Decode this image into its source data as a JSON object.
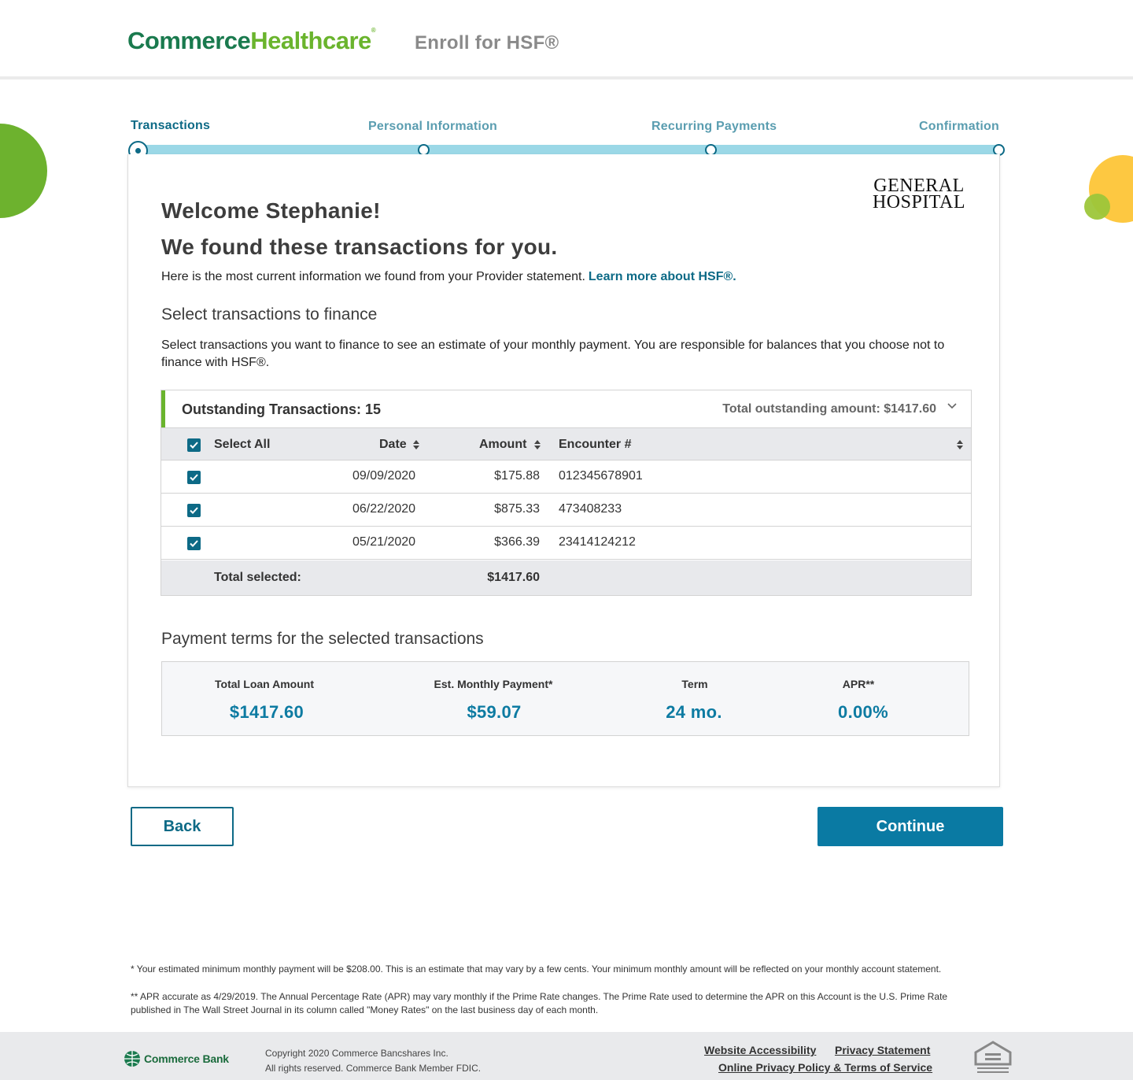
{
  "header": {
    "brand_part1": "Commerce",
    "brand_part2": "Healthcare",
    "brand_mark": "®",
    "page_title": "Enroll for HSF®"
  },
  "stepper": {
    "steps": [
      {
        "label": "Transactions",
        "state": "active"
      },
      {
        "label": "Personal Information",
        "state": "pending"
      },
      {
        "label": "Recurring Payments",
        "state": "pending"
      },
      {
        "label": "Confirmation",
        "state": "pending"
      }
    ]
  },
  "provider_logo": {
    "line1": "GENERAL",
    "line2": "HOSPITAL"
  },
  "welcome": {
    "heading1": "Welcome Stephanie!",
    "heading2": "We found these transactions for you.",
    "intro": "Here is the most current information we found from your Provider statement.",
    "learn_more_link": "Learn more about HSF®."
  },
  "select_section": {
    "title": "Select transactions to finance",
    "description": "Select transactions you want to finance to see an estimate of your monthly payment. You are responsible for balances that you choose not to finance with HSF®."
  },
  "transactions": {
    "header_title": "Outstanding Transactions: 15",
    "total_outstanding": "Total outstanding amount: $1417.60",
    "columns": {
      "select_all": "Select All",
      "date": "Date",
      "amount": "Amount",
      "encounter": "Encounter #"
    },
    "rows": [
      {
        "checked": true,
        "date": "09/09/2020",
        "amount": "$175.88",
        "encounter": "012345678901"
      },
      {
        "checked": true,
        "date": "06/22/2020",
        "amount": "$875.33",
        "encounter": "473408233"
      },
      {
        "checked": true,
        "date": "05/21/2020",
        "amount": "$366.39",
        "encounter": "23414124212"
      }
    ],
    "total_label": "Total selected:",
    "total_value": "$1417.60"
  },
  "payment_terms": {
    "title": "Payment terms for the selected transactions",
    "items": [
      {
        "label": "Total Loan Amount",
        "value": "$1417.60"
      },
      {
        "label": "Est. Monthly Payment*",
        "value": "$59.07"
      },
      {
        "label": "Term",
        "value": "24 mo."
      },
      {
        "label": "APR**",
        "value": "0.00%"
      }
    ]
  },
  "buttons": {
    "back": "Back",
    "continue": "Continue"
  },
  "footnotes": {
    "note1": "*  Your estimated minimum monthly payment will be $208.00.  This is an estimate that may vary by a few cents.  Your minimum monthly amount will be reflected on your monthly account statement.",
    "note2": "** APR accurate as 4/29/2019. The Annual Percentage Rate (APR) may vary monthly if the Prime Rate changes. The Prime Rate used to determine the APR on this Account is the U.S. Prime Rate published in The Wall Street Journal in its column called \"Money Rates\" on the last business day of each month."
  },
  "footer": {
    "bank_name": "Commerce Bank",
    "copyright": "Copyright 2020 Commerce Bancshares Inc.",
    "rights": "All rights reserved. Commerce Bank Member FDIC.",
    "links": {
      "accessibility": "Website Accessibility",
      "privacy": "Privacy Statement",
      "online_privacy": "Online Privacy Policy & Terms of Service"
    }
  },
  "colors": {
    "primary": "#0a7aa3",
    "primary_dark": "#0d6a86",
    "brand_green": "#6ab42d",
    "progress_track": "#9bd8e7"
  }
}
